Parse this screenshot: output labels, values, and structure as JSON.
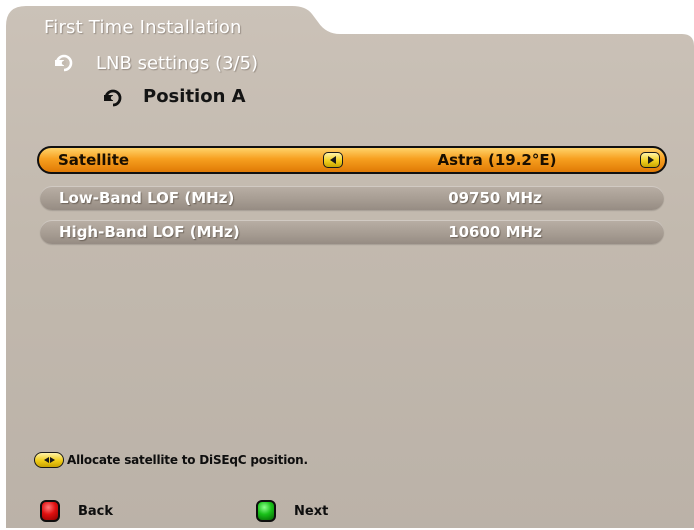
{
  "header": {
    "title": "First Time Installation",
    "subtitle": "LNB settings (3/5)",
    "position": "Position A"
  },
  "rows": [
    {
      "label": "Satellite",
      "value": "Astra (19.2°E)",
      "selected": true
    },
    {
      "label": "Low-Band LOF (MHz)",
      "value": "09750 MHz",
      "selected": false
    },
    {
      "label": "High-Band LOF (MHz)",
      "value": "10600 MHz",
      "selected": false
    }
  ],
  "hint": {
    "icon": "left-right-arrows-icon",
    "text": "Allocate satellite to DiSEqC position."
  },
  "keys": {
    "back": {
      "color": "#e01010",
      "label": "Back"
    },
    "next": {
      "color": "#18c018",
      "label": "Next"
    }
  },
  "colors": {
    "panel_bg": "#c4bbb0",
    "highlight": "#f7a020",
    "row_bg": "#a89e94"
  }
}
